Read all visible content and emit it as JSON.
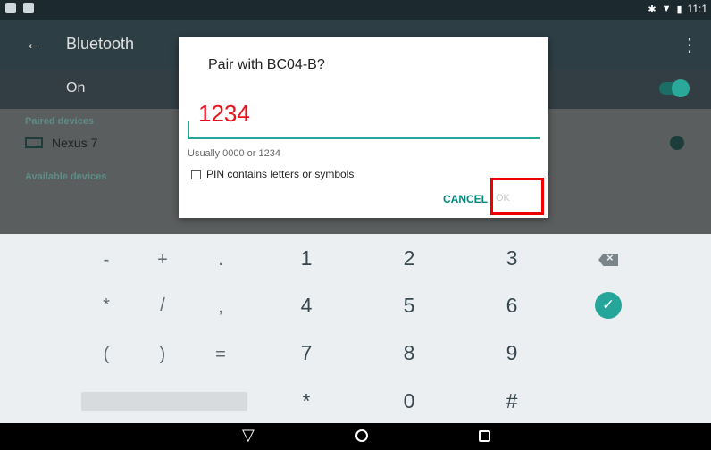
{
  "status_bar": {
    "time": "11:1"
  },
  "settings": {
    "title": "Bluetooth",
    "on_label": "On",
    "paired_header": "Paired devices",
    "paired_device": "Nexus 7",
    "available_header": "Available devices"
  },
  "dialog": {
    "title": "Pair with BC04-B?",
    "pin_value": "1234",
    "hint": "Usually 0000 or 1234",
    "checkbox_label": "PIN contains letters or symbols",
    "cancel_label": "CANCEL",
    "ok_label": "OK"
  },
  "keyboard": {
    "row1": [
      "-",
      "+",
      ".",
      "1",
      "2",
      "3"
    ],
    "row2": [
      "*",
      "/",
      ",",
      "4",
      "5",
      "6"
    ],
    "row3": [
      "(",
      ")",
      "=",
      "7",
      "8",
      "9"
    ],
    "row4": [
      "*",
      "0",
      "#"
    ]
  },
  "icons": {
    "back": "arrow-left",
    "menu": "more-vert",
    "bluetooth": "bluetooth",
    "wifi": "wifi",
    "battery": "battery",
    "laptop": "laptop",
    "gear": "settings",
    "backspace": "backspace",
    "done": "check-circle"
  },
  "colors": {
    "accent": "#26a69a",
    "pin_text": "#e8121d",
    "highlight_box": "#ee0000"
  }
}
